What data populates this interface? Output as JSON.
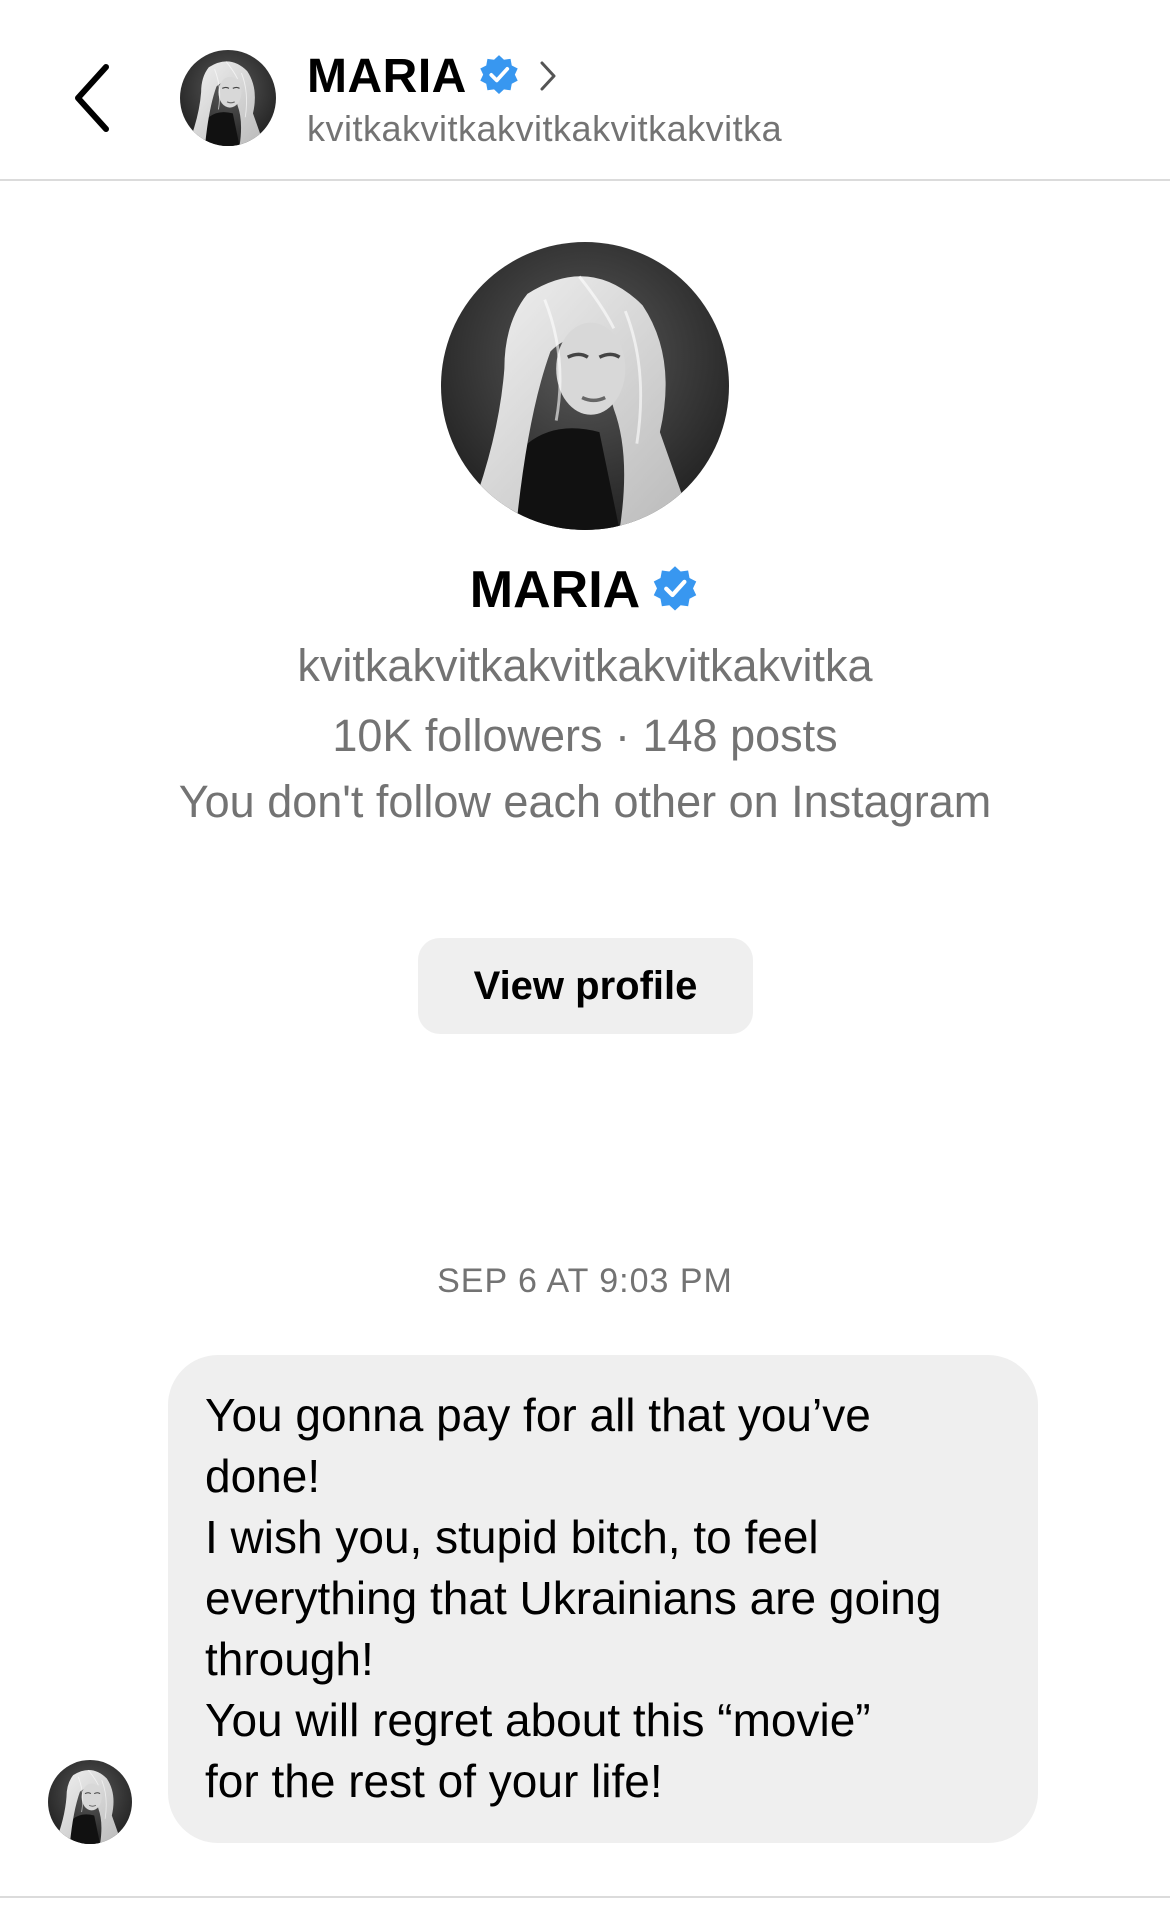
{
  "header": {
    "back_icon": "chevron-left-icon",
    "name": "MARIA",
    "verified_icon": "verified-badge-icon",
    "chevron_icon": "chevron-right-icon",
    "username": "kvitkakvitkakvitkakvitkakvitka"
  },
  "profile": {
    "name": "MARIA",
    "username": "kvitkakvitkakvitkakvitkakvitka",
    "stats": "10K followers · 148 posts",
    "relation": "You don't follow each other on Instagram",
    "view_profile_label": "View profile"
  },
  "thread": {
    "timestamp": "SEP 6 AT 9:03 PM",
    "message_lines": [
      "You gonna pay for all that you’ve",
      "done!",
      "I wish you, stupid bitch, to feel",
      "everything that Ukrainians are going",
      "through!",
      "You will regret about this “movie”",
      "for the rest of your life!"
    ]
  },
  "colors": {
    "verified_blue": "#3897f0",
    "secondary_text": "#737373",
    "bubble_bg": "#efefef",
    "divider": "#dbdbdb"
  }
}
